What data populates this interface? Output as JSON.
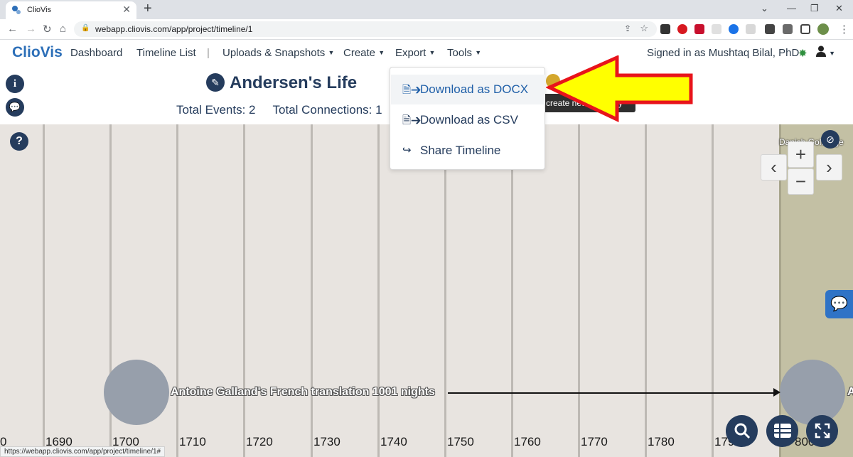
{
  "browser": {
    "tab_title": "ClioVis",
    "tab_close": "✕",
    "new_tab": "+",
    "url": "webapp.cliovis.com/app/project/timeline/1",
    "status_url": "https://webapp.cliovis.com/app/project/timeline/1#"
  },
  "navbar": {
    "brand": "ClioVis",
    "links": [
      "Dashboard",
      "Timeline List",
      "Uploads & Snapshots",
      "Create",
      "Export",
      "Tools"
    ],
    "separator": "|",
    "signed_in": "Signed in as Mushtaq Bilal, PhD"
  },
  "header": {
    "info_icon": "i",
    "title": "Andersen's Life",
    "total_events_label": "Total Events: 2",
    "total_connections_label": "Total Connections: 1",
    "tooltip": "create new category"
  },
  "export_menu": {
    "items": [
      {
        "label": "Download as DOCX",
        "icon": "file-export-icon"
      },
      {
        "label": "Download as CSV",
        "icon": "file-export-icon"
      },
      {
        "label": "Share Timeline",
        "icon": "share-icon"
      }
    ]
  },
  "timeline": {
    "years": [
      "0",
      "1690",
      "1700",
      "1710",
      "1720",
      "1730",
      "1740",
      "1750",
      "1760",
      "1770",
      "1780",
      "179",
      "800"
    ],
    "event_label": "Antoine Galland's French translation 1001 nights",
    "event_label_2": "A",
    "period_label": "Danish Gol...Age",
    "zoom_in": "+",
    "zoom_out": "−",
    "prev": "‹",
    "next": "›"
  },
  "colors": {
    "brand": "#2d6fb8",
    "navy": "#253c5d",
    "canvas": "#e8e4e0",
    "arrow_fill": "#ffff00",
    "arrow_stroke": "#e8141b"
  }
}
